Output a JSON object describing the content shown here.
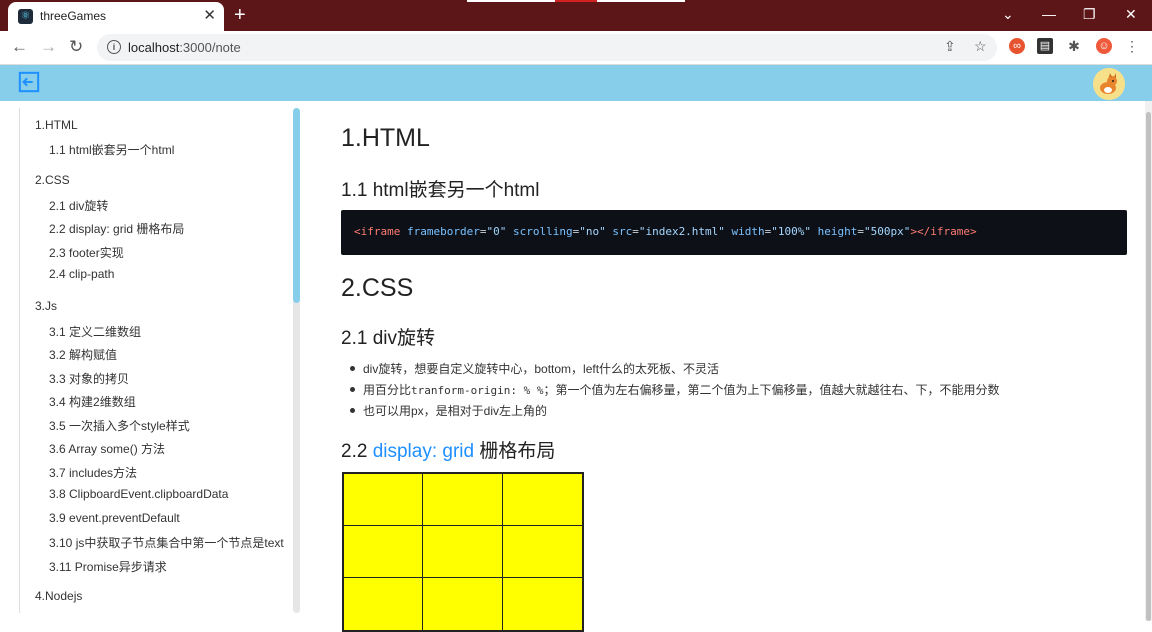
{
  "browser": {
    "tab_title": "threeGames",
    "tab_close": "✕",
    "new_tab": "+",
    "url_host": "localhost",
    "url_rest": ":3000/note"
  },
  "toc": [
    {
      "label": "1.HTML",
      "level": 1
    },
    {
      "label": "1.1 html嵌套另一个html",
      "level": 2
    },
    {
      "label": "2.CSS",
      "level": 1
    },
    {
      "label": "2.1 div旋转",
      "level": 2
    },
    {
      "label": "2.2 display: grid 栅格布局",
      "level": 2
    },
    {
      "label": "2.3 footer实现",
      "level": 2
    },
    {
      "label": "2.4 clip-path",
      "level": 2
    },
    {
      "label": "3.Js",
      "level": 1
    },
    {
      "label": "3.1 定义二维数组",
      "level": 2
    },
    {
      "label": "3.2 解构赋值",
      "level": 2
    },
    {
      "label": "3.3 对象的拷贝",
      "level": 2
    },
    {
      "label": "3.4 构建2维数组",
      "level": 2
    },
    {
      "label": "3.5 一次插入多个style样式",
      "level": 2
    },
    {
      "label": "3.6 Array some() 方法",
      "level": 2
    },
    {
      "label": "3.7 includes方法",
      "level": 2
    },
    {
      "label": "3.8 ClipboardEvent.clipboardData",
      "level": 2
    },
    {
      "label": "3.9 event.preventDefault",
      "level": 2
    },
    {
      "label": "3.10 js中获取子节点集合中第一个节点是text",
      "level": 2
    },
    {
      "label": "3.11 Promise异步请求",
      "level": 2
    },
    {
      "label": "4.Nodejs",
      "level": 1
    }
  ],
  "content": {
    "h1_html": "1.HTML",
    "h2_html_nest": "1.1 html嵌套另一个html",
    "code": {
      "tag_open": "<iframe",
      "attr1": "frameborder",
      "val1": "\"0\"",
      "attr2": "scrolling",
      "val2": "\"no\"",
      "attr3": "src",
      "val3": "\"index2.html\"",
      "attr4": "width",
      "val4": "\"100%\"",
      "attr5": "height",
      "val5": "\"500px\"",
      "tag_close": "></iframe>"
    },
    "h1_css": "2.CSS",
    "h2_div_rotate": "2.1 div旋转",
    "bullets": {
      "b1": "div旋转，想要自定义旋转中心，bottom，left什么的太死板、不灵活",
      "b2_pre": "用百分比",
      "b2_code": "tranform-origin: % %",
      "b2_post": "；第一个值为左右偏移量，第二个值为上下偏移量，值越大就越往右、下，不能用分数",
      "b3": "也可以用px，是相对于div左上角的"
    },
    "h2_grid_prefix": "2.2 ",
    "h2_grid_link": "display: grid",
    "h2_grid_suffix": " 栅格布局"
  },
  "colors": {
    "titlebar": "#5c1618",
    "appbar": "#87ceeb",
    "link": "#1e90ff",
    "grid_fill": "#ffff00",
    "code_bg": "#0d1117"
  }
}
